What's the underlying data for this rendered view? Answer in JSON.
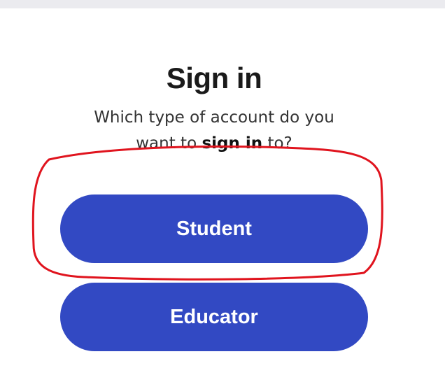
{
  "signin": {
    "title": "Sign in",
    "subtitle_part1": "Which type of account do you want to ",
    "subtitle_bold": "sign in",
    "subtitle_part2": " to?"
  },
  "buttons": {
    "student_label": "Student",
    "educator_label": "Educator"
  },
  "colors": {
    "button_bg": "#3249c3",
    "highlight": "#e0141e"
  }
}
